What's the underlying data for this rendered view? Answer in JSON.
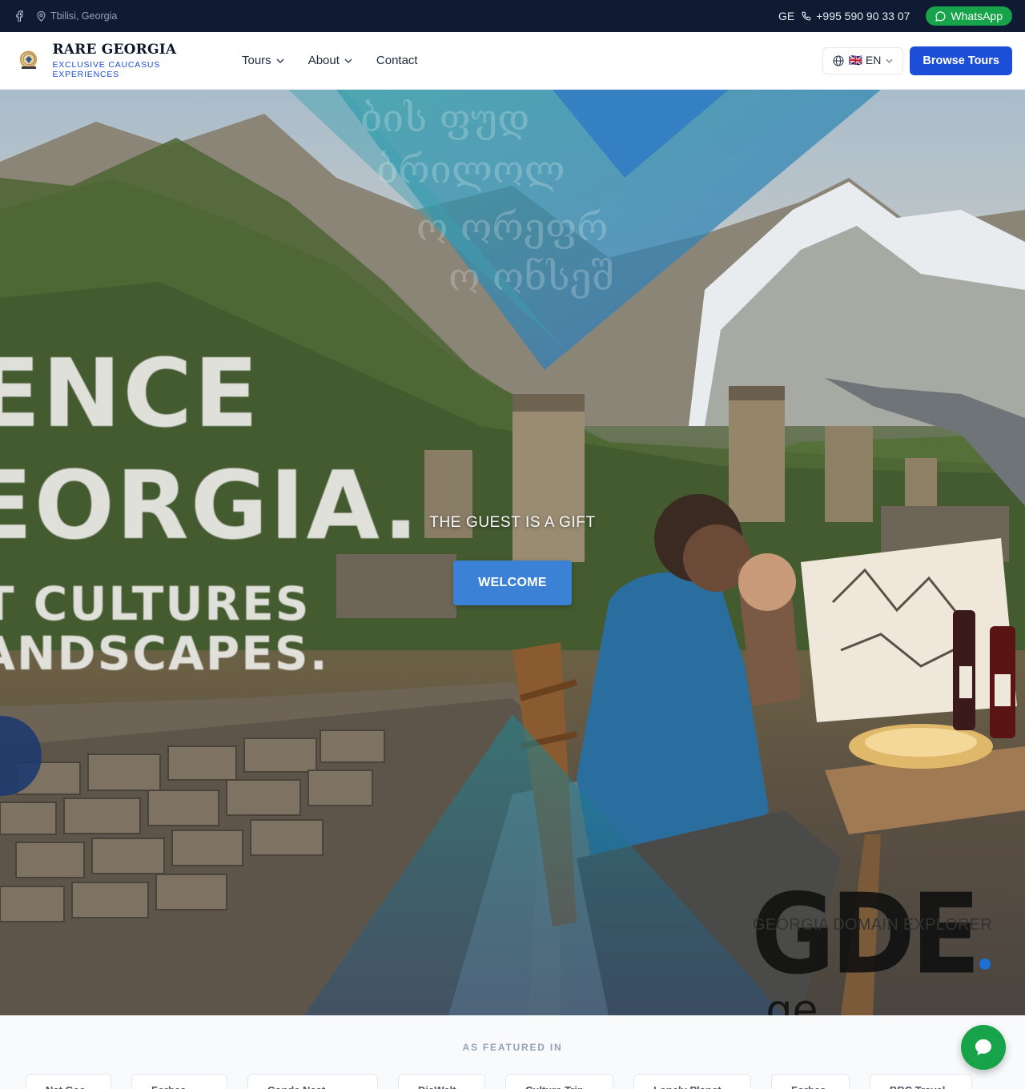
{
  "topbar": {
    "location": "Tbilisi, Georgia",
    "lang_code": "GE",
    "phone": "+995 590 90 33 07",
    "whatsapp_label": "WhatsApp"
  },
  "header": {
    "brand_title": "RARE GEORGIA",
    "brand_subtitle": "EXCLUSIVE CAUCASUS EXPERIENCES",
    "nav": [
      {
        "label": "Tours",
        "has_dropdown": true
      },
      {
        "label": "About",
        "has_dropdown": true
      },
      {
        "label": "Contact",
        "has_dropdown": false
      }
    ],
    "language_label": "🇬🇧 EN",
    "cta_label": "Browse Tours"
  },
  "hero": {
    "image_text": [
      "ENCE",
      "EORGIA.",
      "T CULTURES",
      "ANDSCAPES."
    ],
    "background_script": [
      "ბის ფუდ",
      "ბრილოლ",
      "ო ორეფრ",
      "ო ონსეშ"
    ],
    "tagline": "THE GUEST IS A GIFT",
    "cta_label": "WELCOME",
    "watermark_logo": "GDE",
    "watermark_tld": ".ge",
    "watermark_subtitle": "GEORGIA DOMAIN EXPLORER"
  },
  "featured": {
    "title": "AS FEATURED IN",
    "items": [
      "Nat Geo",
      "Forbes",
      "Conde Nast",
      "DiaWelt",
      "Culture Trip",
      "Lonely Planet",
      "Forbes",
      "BBC Travel"
    ]
  },
  "colors": {
    "topbar_bg": "#111a33",
    "primary": "#1d4ed8",
    "whatsapp": "#16a34a",
    "welcome_button": "#3b82d6"
  },
  "icons": {
    "facebook": "facebook-icon",
    "location": "map-pin-icon",
    "phone": "phone-icon",
    "whatsapp": "whatsapp-icon",
    "globe": "globe-icon",
    "chevron": "chevron-down-icon",
    "chat": "chat-bubble-icon"
  }
}
